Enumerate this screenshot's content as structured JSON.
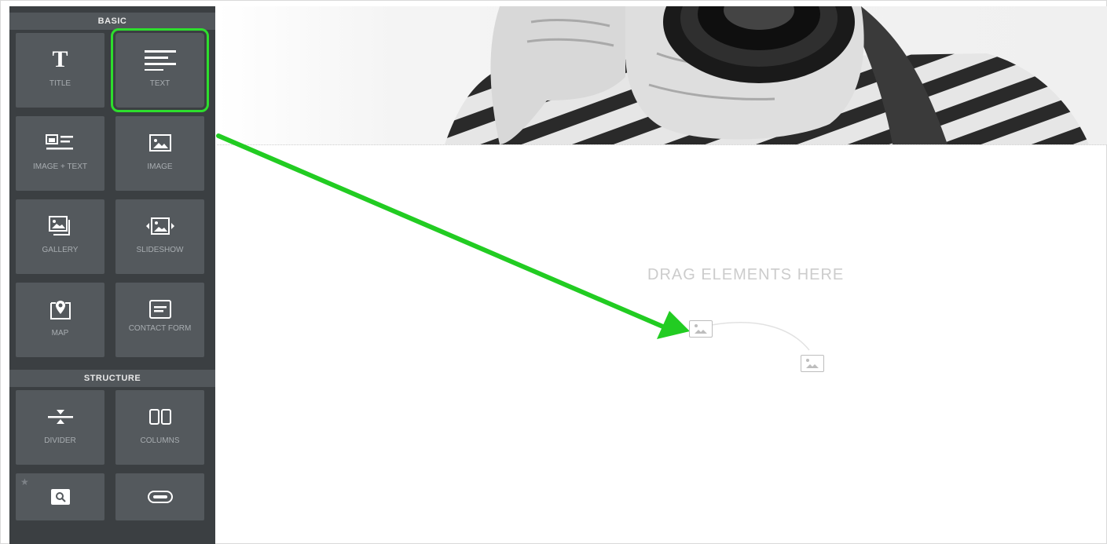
{
  "sidebar": {
    "basic_header": "BASIC",
    "structure_header": "STRUCTURE",
    "basic_items": [
      {
        "label": "TITLE",
        "icon": "title-icon"
      },
      {
        "label": "TEXT",
        "icon": "text-icon"
      },
      {
        "label": "IMAGE + TEXT",
        "icon": "image-text-icon"
      },
      {
        "label": "IMAGE",
        "icon": "image-icon"
      },
      {
        "label": "GALLERY",
        "icon": "gallery-icon"
      },
      {
        "label": "SLIDESHOW",
        "icon": "slideshow-icon"
      },
      {
        "label": "MAP",
        "icon": "map-pin-icon"
      },
      {
        "label": "CONTACT FORM",
        "icon": "contact-form-icon"
      }
    ],
    "structure_items": [
      {
        "label": "DIVIDER",
        "icon": "divider-icon"
      },
      {
        "label": "COLUMNS",
        "icon": "columns-icon"
      },
      {
        "label": "",
        "icon": "search-icon"
      },
      {
        "label": "",
        "icon": "button-icon"
      }
    ],
    "star_glyph": "★"
  },
  "canvas": {
    "drop_text": "DRAG ELEMENTS HERE"
  },
  "colors": {
    "sidebar_bg": "#3b3f42",
    "tile_bg": "#54595d",
    "highlight": "#2dde2d",
    "arrow": "#22cc22"
  }
}
